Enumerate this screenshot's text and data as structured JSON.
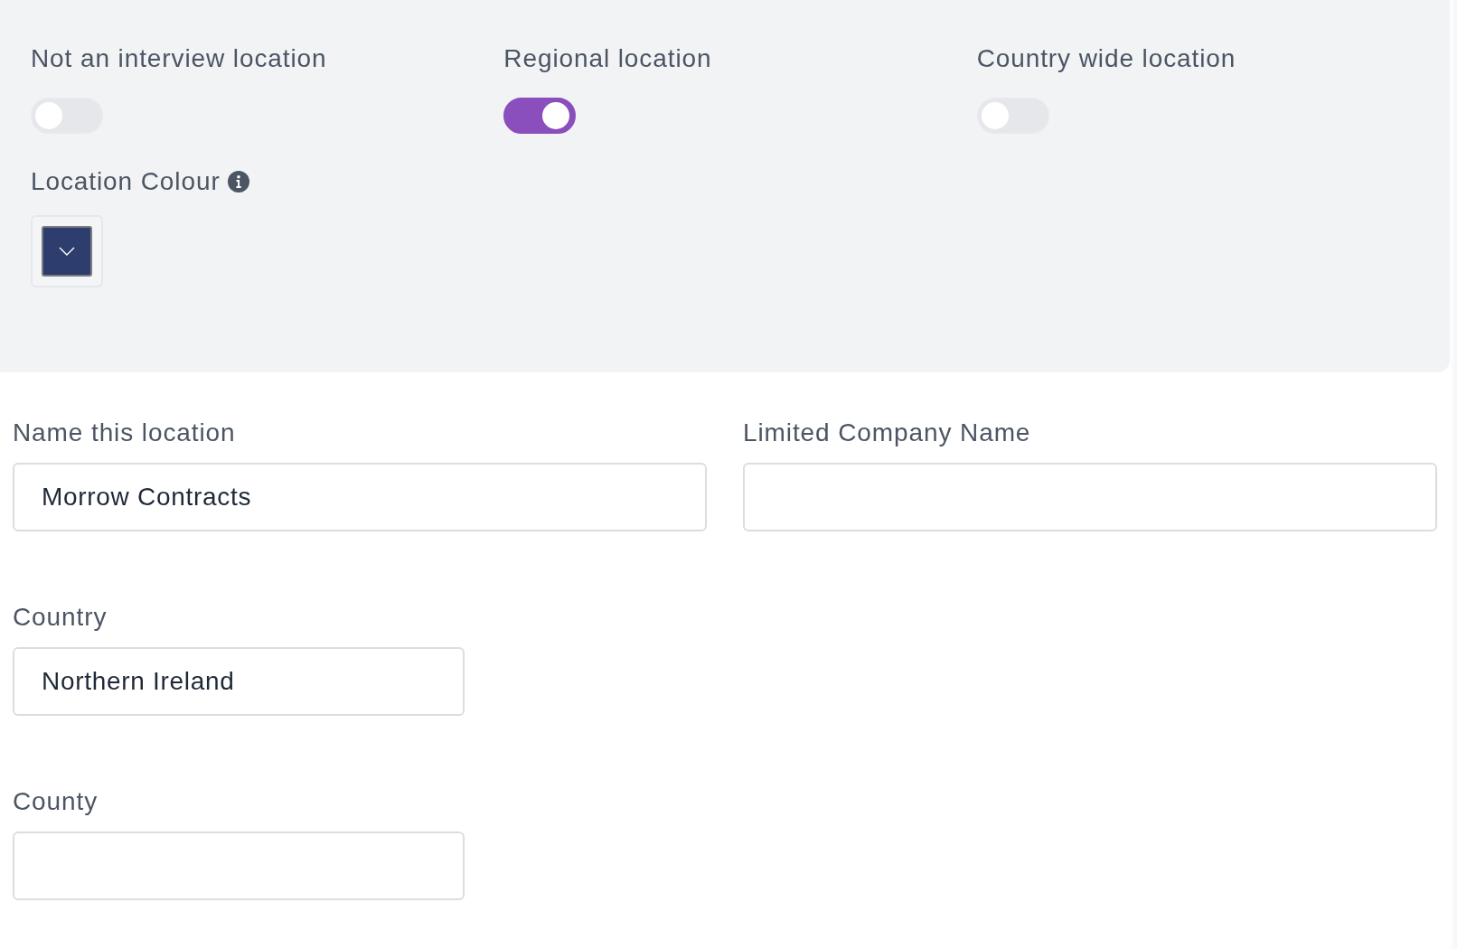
{
  "toggles": [
    {
      "label": "Not an interview location",
      "on": false
    },
    {
      "label": "Regional location",
      "on": true
    },
    {
      "label": "Country wide location",
      "on": false
    }
  ],
  "location_colour": {
    "label": "Location Colour",
    "color": "#2d3e6e"
  },
  "fields": [
    {
      "label": "Name this location",
      "value": "Morrow Contracts"
    },
    {
      "label": "Limited Company Name"
    },
    {
      "label": "Country",
      "value": "Northern Ireland"
    },
    {
      "label": "County"
    }
  ]
}
